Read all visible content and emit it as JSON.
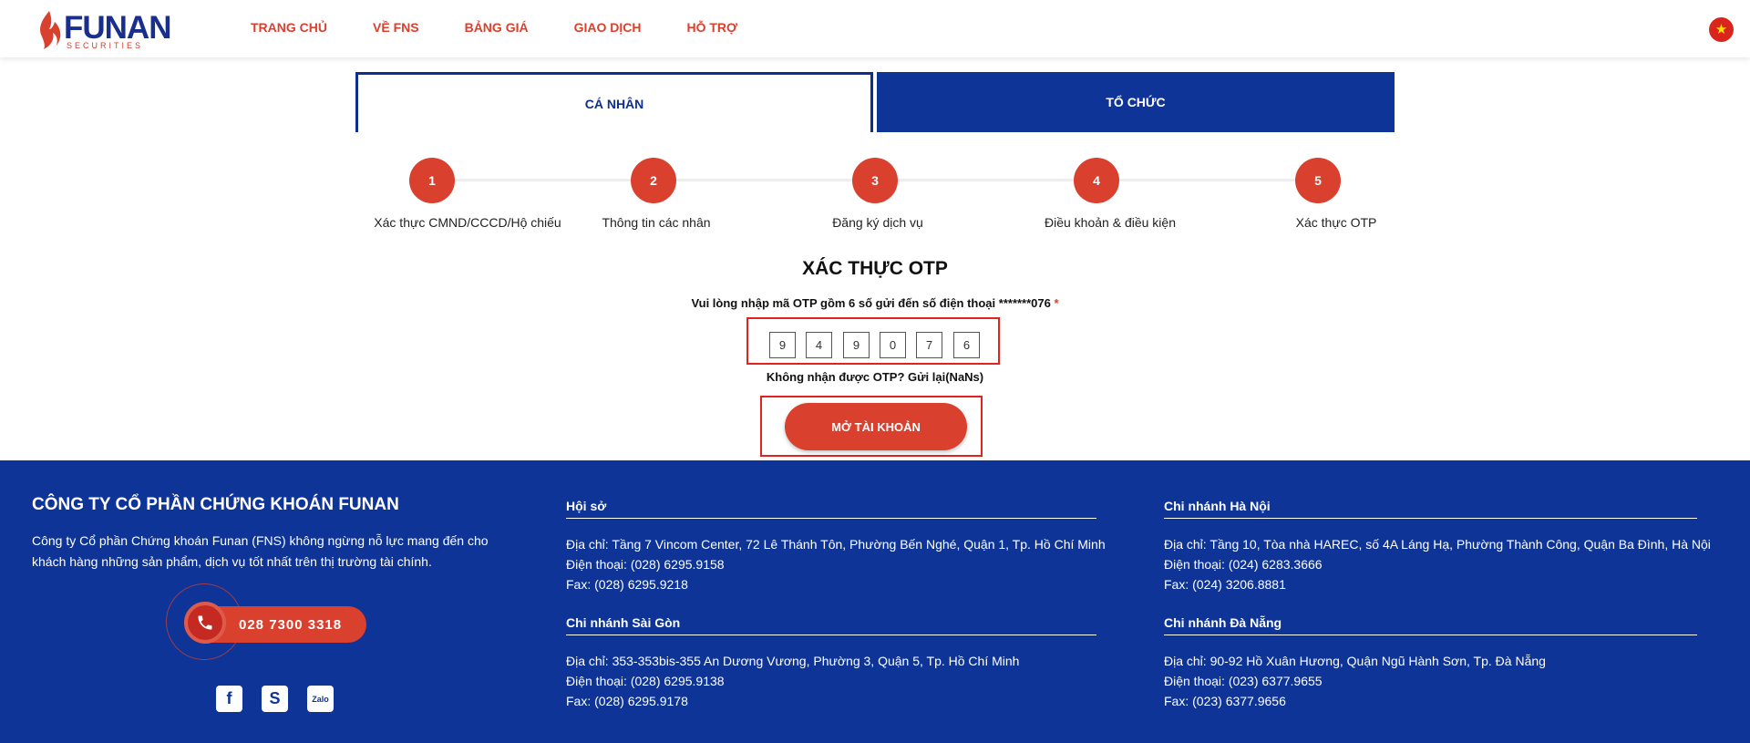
{
  "header": {
    "logo_text": "FUNAN",
    "logo_sub": "SECURITIES",
    "nav": [
      "TRANG CHỦ",
      "VỀ FNS",
      "BẢNG GIÁ",
      "GIAO DỊCH",
      "HỖ TRỢ"
    ]
  },
  "tabs": {
    "personal": "CÁ NHÂN",
    "organization": "TỔ CHỨC"
  },
  "steps": [
    {
      "num": "1",
      "label": "Xác thực CMND/CCCD/Hộ chiếu"
    },
    {
      "num": "2",
      "label": "Thông tin các nhân"
    },
    {
      "num": "3",
      "label": "Đăng ký dịch vụ"
    },
    {
      "num": "4",
      "label": "Điều khoản & điều kiện"
    },
    {
      "num": "5",
      "label": "Xác thực OTP"
    }
  ],
  "otp": {
    "title": "XÁC THỰC OTP",
    "description": "Vui lòng nhập mã OTP gồm 6 số gửi đến số điện thoại *******076",
    "required_mark": "*",
    "digits": [
      "9",
      "4",
      "9",
      "0",
      "7",
      "6"
    ],
    "resend": "Không nhận được OTP? Gửi lại(NaNs)",
    "submit": "MỞ TÀI KHOẢN"
  },
  "footer": {
    "company": "CÔNG TY CỔ PHẦN CHỨNG KHOÁN FUNAN",
    "description": "Công ty Cổ phần Chứng khoán Funan (FNS) không ngừng nỗ lực mang đến cho khách hàng những sản phẩm, dịch vụ tốt nhất trên thị trường tài chính.",
    "hotline": "028 7300 3318",
    "socials": [
      "facebook-icon",
      "skype-icon",
      "zalo-icon"
    ],
    "zalo_text": "Zalo",
    "offices": [
      {
        "name": "Hội sở",
        "address": "Địa chỉ: Tầng 7 Vincom Center, 72 Lê Thánh Tôn, Phường Bến Nghé, Quận 1, Tp. Hồ Chí Minh",
        "phone": "Điện thoại: (028) 6295.9158",
        "fax": "Fax: (028) 6295.9218"
      },
      {
        "name": "Chi nhánh Sài Gòn",
        "address": "Địa chỉ: 353-353bis-355 An Dương Vương, Phường 3, Quận 5, Tp. Hồ Chí Minh",
        "phone": "Điện thoại: (028) 6295.9138",
        "fax": "Fax: (028) 6295.9178"
      },
      {
        "name": "Chi nhánh Hà Nội",
        "address": "Địa chỉ: Tầng 10, Tòa nhà HAREC, số 4A Láng Hạ, Phường Thành Công, Quận Ba Đình, Hà Nội",
        "phone": "Điện thoại: (024) 6283.3666",
        "fax": "Fax: (024) 3206.8881"
      },
      {
        "name": "Chi nhánh Đà Nẵng",
        "address": "Địa chỉ: 90-92 Hồ Xuân Hương, Quận Ngũ Hành Sơn, Tp. Đà Nẵng",
        "phone": "Điện thoại: (023) 6377.9655",
        "fax": "Fax: (023) 6377.9656"
      }
    ]
  },
  "colors": {
    "brand_red": "#d9402e",
    "brand_blue": "#0e3497",
    "highlight_red": "#e0231e"
  }
}
